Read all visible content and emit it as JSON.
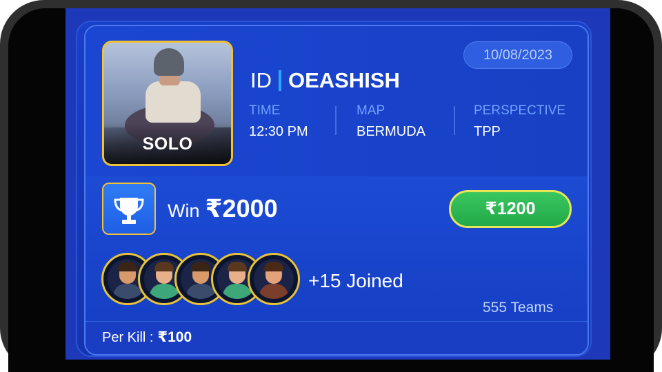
{
  "match": {
    "mode": "SOLO",
    "date": "10/08/2023",
    "id_prefix": "ID",
    "id_name": "OEASHISH",
    "time_label": "TIME",
    "time_value": "12:30 PM",
    "map_label": "MAP",
    "map_value": "BERMUDA",
    "perspective_label": "PERSPECTIVE",
    "perspective_value": "TPP"
  },
  "prize": {
    "win_label": "Win",
    "win_amount": "₹2000",
    "entry_fee": "₹1200"
  },
  "players": {
    "joined_text": "+15 Joined",
    "teams_text": "555 Teams",
    "avatar_count": 5
  },
  "per_kill": {
    "label": "Per Kill :",
    "amount": "₹100"
  },
  "colors": {
    "card_blue": "#1844cd",
    "accent_gold": "#f1c136",
    "button_green": "#2cb552",
    "button_border": "#e9e657",
    "label_blue": "#6ea3ff"
  },
  "icons": {
    "trophy": "trophy-icon"
  }
}
